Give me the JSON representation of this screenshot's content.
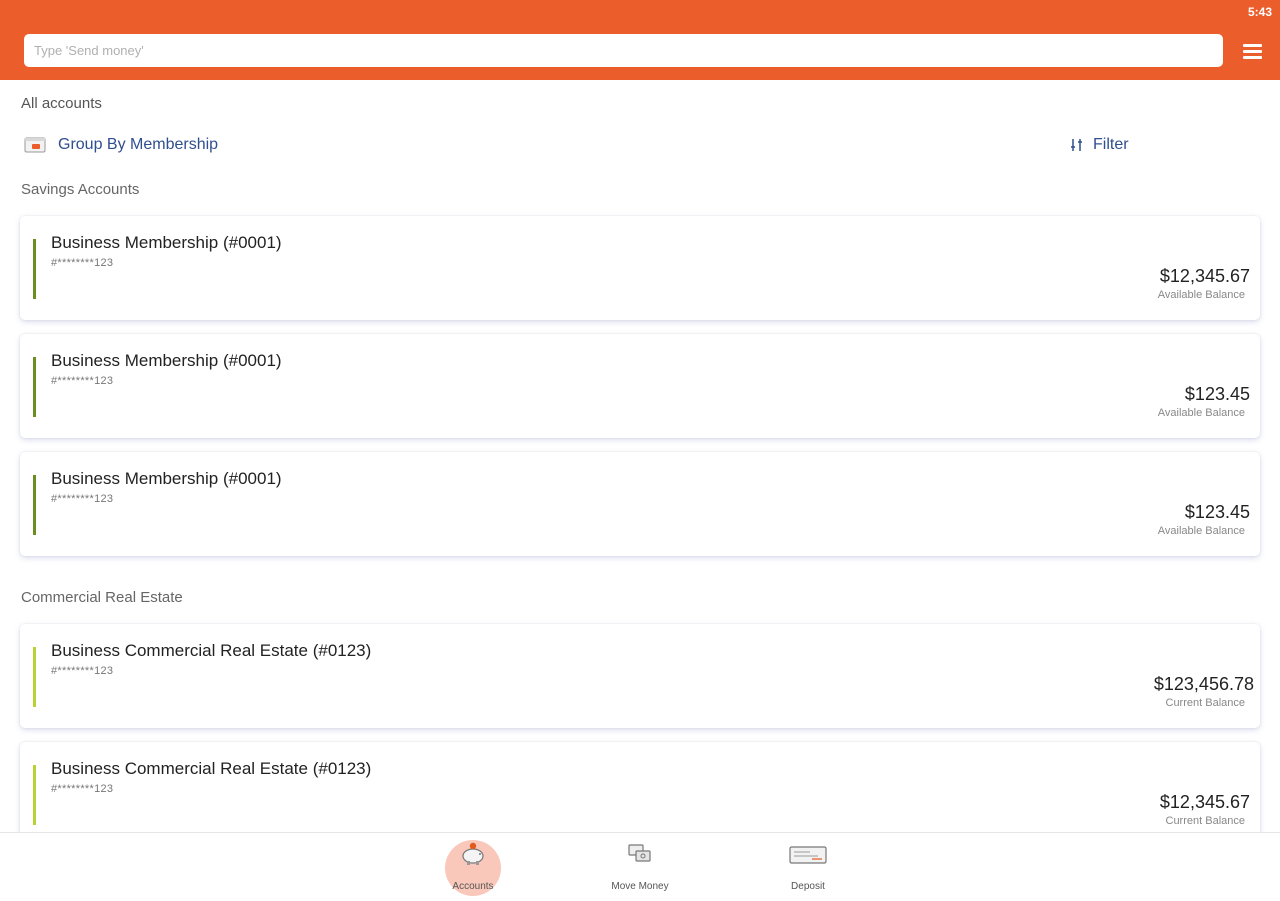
{
  "status": {
    "time": "5:43"
  },
  "search": {
    "placeholder": "Type 'Send money'"
  },
  "page": {
    "title": "All accounts"
  },
  "toolbar": {
    "group_by_label": "Group By Membership",
    "filter_label": "Filter"
  },
  "sections": [
    {
      "title": "Savings Accounts",
      "accounts": [
        {
          "name": "Business Membership (#0001)",
          "number": "#********123",
          "amount": "$12,345.67",
          "balance_label": "Available Balance"
        },
        {
          "name": "Business Membership (#0001)",
          "number": "#********123",
          "amount": "$123.45",
          "balance_label": "Available Balance"
        },
        {
          "name": "Business Membership (#0001)",
          "number": "#********123",
          "amount": "$123.45",
          "balance_label": "Available Balance"
        }
      ]
    },
    {
      "title": "Commercial Real Estate",
      "accounts": [
        {
          "name": "Business Commercial Real Estate (#0123)",
          "number": "#********123",
          "amount": "$123,456.78",
          "balance_label": "Current Balance"
        },
        {
          "name": "Business Commercial Real Estate (#0123)",
          "number": "#********123",
          "amount": "$12,345.67",
          "balance_label": "Current Balance"
        }
      ]
    }
  ],
  "bottom_nav": {
    "items": [
      {
        "label": "Accounts",
        "icon": "piggy-bank-icon",
        "active": true
      },
      {
        "label": "Move Money",
        "icon": "money-transfer-icon",
        "active": false
      },
      {
        "label": "Deposit",
        "icon": "check-deposit-icon",
        "active": false
      }
    ]
  },
  "colors": {
    "header": "#EB5E2B",
    "link": "#2F4F8F",
    "savings_bar": "#6B8E23",
    "real_estate_bar": "#B5D334",
    "active_nav_bg": "#F9C8BA"
  }
}
